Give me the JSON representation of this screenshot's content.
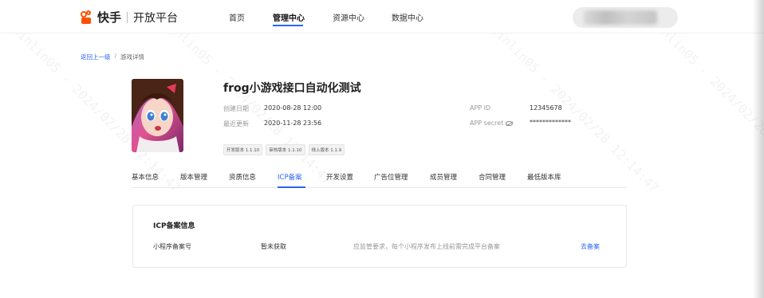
{
  "brand": {
    "name": "快手",
    "product": "开放平台"
  },
  "nav": {
    "items": [
      {
        "label": "首页"
      },
      {
        "label": "管理中心"
      },
      {
        "label": "资源中心"
      },
      {
        "label": "数据中心"
      }
    ],
    "active": "管理中心"
  },
  "breadcrumb": {
    "back": "返回上一级",
    "separator": "/",
    "current": "游戏详情"
  },
  "game": {
    "title": "frog小游戏接口自动化测试",
    "created_label": "创建日期",
    "created_value": "2020-08-28 12:00",
    "updated_label": "最近更新",
    "updated_value": "2020-11-28 23:56",
    "appid_label": "APP ID",
    "appid_value": "12345678",
    "secret_label": "APP secret",
    "secret_value": "*************",
    "versions": [
      {
        "label": "开发版本 1.1.10"
      },
      {
        "label": "审核版本 1.1.10"
      },
      {
        "label": "线上版本 1.1.9"
      }
    ]
  },
  "tabs": [
    {
      "label": "基本信息"
    },
    {
      "label": "版本管理"
    },
    {
      "label": "资质信息"
    },
    {
      "label": "ICP备案"
    },
    {
      "label": "开发设置"
    },
    {
      "label": "广告位管理"
    },
    {
      "label": "成员管理"
    },
    {
      "label": "合同管理"
    },
    {
      "label": "最低版本库"
    }
  ],
  "active_tab": "ICP备案",
  "icp": {
    "title": "ICP备案信息",
    "row_label": "小程序备案号",
    "row_value": "暂未获取",
    "tip": "应监管要求，每个小程序发布上线前需完成平台备案",
    "action": "去备案"
  },
  "watermark": {
    "text": "xulinlin05 - 2024/02/28 12:14:47"
  },
  "colors": {
    "accent": "#2b64f3",
    "brand": "#ff5000"
  }
}
